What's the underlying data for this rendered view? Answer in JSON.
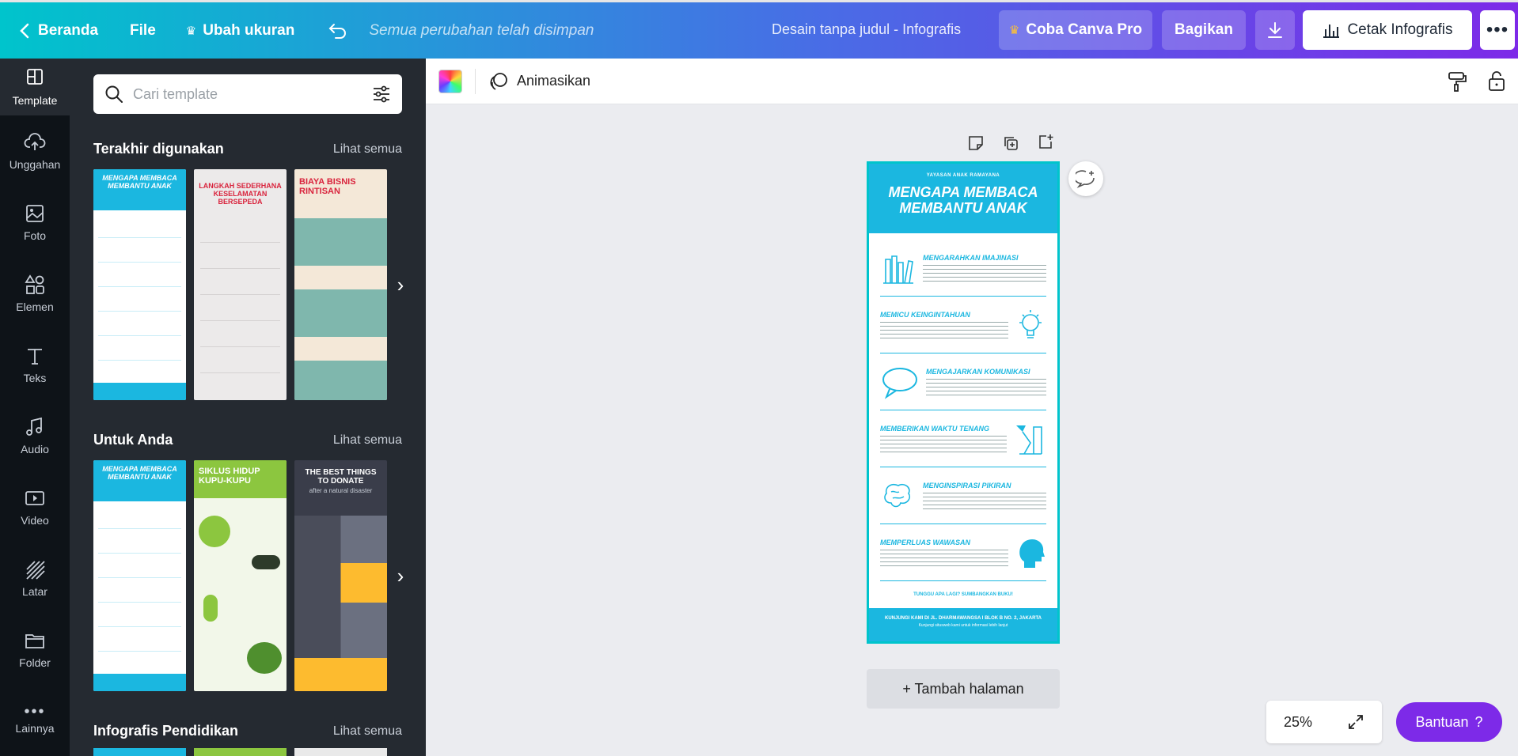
{
  "topbar": {
    "home_label": "Beranda",
    "file_label": "File",
    "resize_label": "Ubah ukuran",
    "saved_status": "Semua perubahan telah disimpan",
    "doc_title": "Desain tanpa judul - Infografis",
    "pro_label": "Coba Canva Pro",
    "share_label": "Bagikan",
    "print_label": "Cetak Infografis"
  },
  "rail": {
    "items": [
      "Template",
      "Unggahan",
      "Foto",
      "Elemen",
      "Teks",
      "Audio",
      "Video",
      "Latar",
      "Folder",
      "Lainnya"
    ]
  },
  "panel": {
    "search_placeholder": "Cari template",
    "sections": [
      {
        "title": "Terakhir digunakan",
        "link": "Lihat semua"
      },
      {
        "title": "Untuk Anda",
        "link": "Lihat semua"
      },
      {
        "title": "Infografis Pendidikan",
        "link": "Lihat semua"
      }
    ],
    "thumbs_recent": [
      {
        "heading": "MENGAPA MEMBACA MEMBANTU ANAK"
      },
      {
        "heading": "LANGKAH SEDERHANA KESELAMATAN BERSEPEDA"
      },
      {
        "heading": "BIAYA BISNIS RINTISAN"
      }
    ],
    "thumbs_foryou": [
      {
        "heading": "MENGAPA MEMBACA MEMBANTU ANAK"
      },
      {
        "heading": "SIKLUS HIDUP KUPU-KUPU"
      },
      {
        "heading": "THE BEST THINGS TO DONATE",
        "subheading": "after a natural disaster"
      }
    ]
  },
  "toolbar2": {
    "animate_label": "Animasikan"
  },
  "canvas": {
    "org": "YAYASAN ANAK RAMAYANA",
    "title": "MENGAPA MEMBACA MEMBANTU ANAK",
    "items": [
      "MENGARAHKAN IMAJINASI",
      "MEMICU KEINGINTAHUAN",
      "MENGAJARKAN KOMUNIKASI",
      "MEMBERIKAN WAKTU TENANG",
      "MENGINSPIRASI PIKIRAN",
      "MEMPERLUAS WAWASAN"
    ],
    "cta": "TUNGGU APA LAGI? SUMBANGKAN BUKU!",
    "footer": "KUNJUNGI KAMI DI JL. DHARMAWANGSA I BLOK B NO. 2, JAKARTA",
    "footer_sub": "Kunjungi situsweb kami untuk informasi lebih lanjut"
  },
  "add_page_label": "+ Tambah halaman",
  "zoom_level": "25%",
  "help_label": "Bantuan",
  "help_glyph": "?",
  "colors": {
    "accent": "#00c4cc",
    "brand_purple": "#7d2ae8",
    "infographic_blue": "#1bb7e0"
  }
}
